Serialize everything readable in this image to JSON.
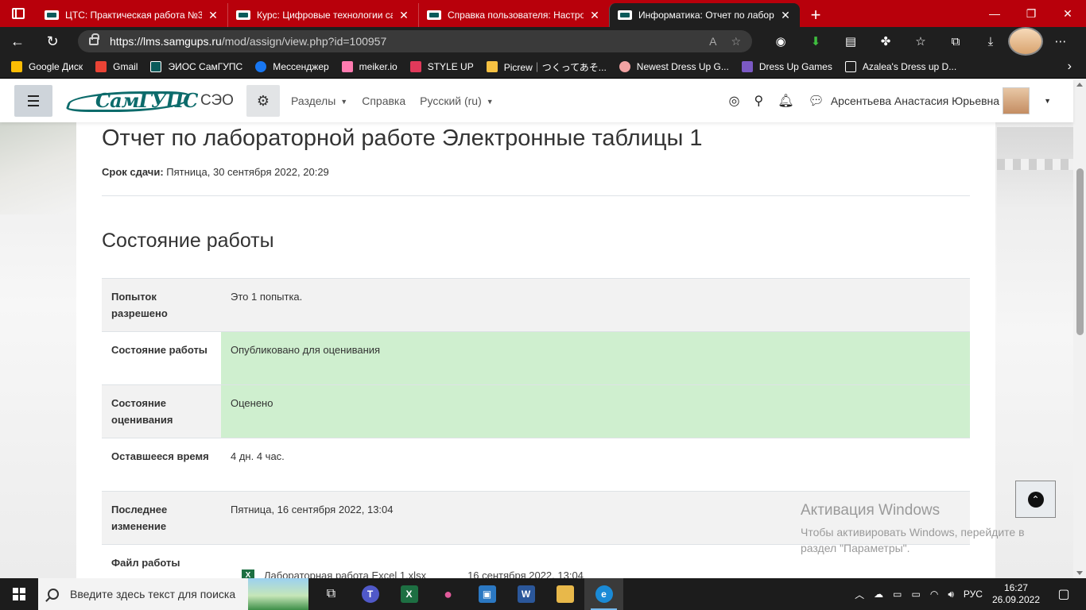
{
  "browser": {
    "tabs": [
      {
        "title": "ЦТС: Практическая работа №3",
        "active": false
      },
      {
        "title": "Курс: Цифровые технологии са",
        "active": false
      },
      {
        "title": "Справка пользователя: Настрой",
        "active": false
      },
      {
        "title": "Информатика: Отчет по лабора",
        "active": true
      }
    ],
    "new_tab": "+",
    "url_host": "https://lms.samgups.ru",
    "url_path": "/mod/assign/view.php?id=100957",
    "bookmarks": [
      {
        "label": "Google Диск",
        "color": "#fbbc04"
      },
      {
        "label": "Gmail",
        "color": "#ea4335"
      },
      {
        "label": "ЭИОС СамГУПС",
        "color": "#0a5a5a"
      },
      {
        "label": "Мессенджер",
        "color": "#1877f2"
      },
      {
        "label": "meiker.io",
        "color": "#ff7bb0"
      },
      {
        "label": "STYLE UP",
        "color": "#e0395a"
      },
      {
        "label": "Picrew｜つくってあそ...",
        "color": "#f6c142"
      },
      {
        "label": "Newest Dress Up G...",
        "color": "#f2a3a3"
      },
      {
        "label": "Dress Up Games",
        "color": "#7b59c4"
      },
      {
        "label": "Azalea's Dress up D...",
        "color": "#ffffff"
      }
    ]
  },
  "moodle": {
    "site_name": "СЭО",
    "logo_text": "СамГУПС",
    "nav": [
      {
        "label": "Разделы",
        "caret": true
      },
      {
        "label": "Справка",
        "caret": false
      },
      {
        "label": "Русский (ru)",
        "caret": true
      }
    ],
    "user_name": "Арсентьева Анастасия Юрьевна"
  },
  "assignment": {
    "title": "Отчет по лабораторной работе Электронные таблицы 1",
    "due_label": "Срок сдачи:",
    "due_value": "Пятница, 30 сентября 2022, 20:29",
    "status_heading": "Состояние работы",
    "rows": [
      {
        "label": "Попыток разрешено",
        "value": "Это 1 попытка.",
        "green": false,
        "odd": true
      },
      {
        "label": "Состояние работы",
        "value": "Опубликовано для оценивания",
        "green": true,
        "odd": false
      },
      {
        "label": "Состояние оценивания",
        "value": "Оценено",
        "green": true,
        "odd": true
      },
      {
        "label": "Оставшееся время",
        "value": "4 дн. 4 час.",
        "green": false,
        "odd": false
      },
      {
        "label": "Последнее изменение",
        "value": "Пятница, 16 сентября 2022, 13:04",
        "green": false,
        "odd": true
      }
    ],
    "file_row": {
      "label": "Файл работы",
      "file_name": "Лабораторная работа Excel 1.xlsx",
      "file_date": "16 сентября 2022, 13:04"
    }
  },
  "watermark": {
    "title": "Активация Windows",
    "text": "Чтобы активировать Windows, перейдите в раздел \"Параметры\"."
  },
  "taskbar": {
    "search_placeholder": "Введите здесь текст для поиска",
    "apps": [
      {
        "name": "task-view",
        "label": "⧉",
        "color": "transparent"
      },
      {
        "name": "teams",
        "label": "T",
        "color": "#5059c9"
      },
      {
        "name": "excel",
        "label": "X",
        "color": "#1d6f42"
      },
      {
        "name": "paint",
        "label": "●",
        "color": "#e05a9a"
      },
      {
        "name": "photos",
        "label": "▣",
        "color": "#2b78c2"
      },
      {
        "name": "word",
        "label": "W",
        "color": "#2b579a"
      },
      {
        "name": "explorer",
        "label": "▬",
        "color": "#e8b84a"
      },
      {
        "name": "edge",
        "label": "e",
        "color": "#1a8ad6"
      }
    ],
    "language": "РУС",
    "time": "16:27",
    "date": "26.09.2022"
  }
}
